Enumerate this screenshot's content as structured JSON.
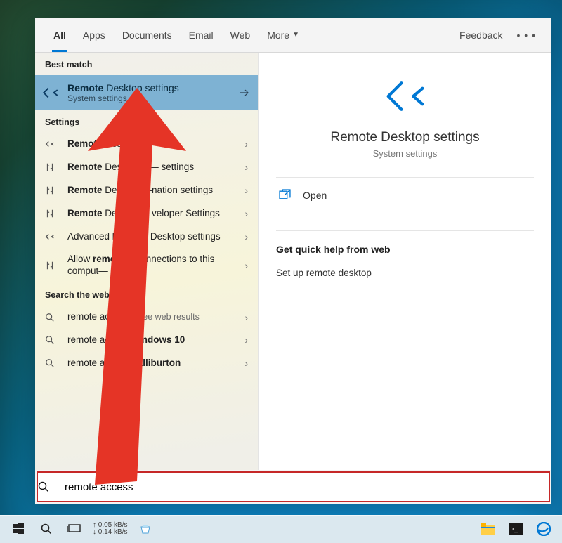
{
  "tabs": {
    "items": [
      "All",
      "Apps",
      "Documents",
      "Email",
      "Web",
      "More"
    ],
    "feedback": "Feedback"
  },
  "left": {
    "best_header": "Best match",
    "best": {
      "title_bold": "Remote",
      "title_rest": " Desktop settings",
      "subtitle": "System settings"
    },
    "settings_header": "Settings",
    "settings": [
      {
        "icon": "remote",
        "pre": "",
        "bold": "Remote",
        "post": " Desktop"
      },
      {
        "icon": "sliders",
        "pre": "",
        "bold": "Remote",
        "post": " Desktop sl— settings"
      },
      {
        "icon": "sliders",
        "pre": "",
        "bold": "Remote",
        "post": " Desktop —nation settings"
      },
      {
        "icon": "sliders",
        "pre": "",
        "bold": "Remote",
        "post": " Desktop —veloper Settings"
      },
      {
        "icon": "remote",
        "pre": "Advanced ",
        "bold": "Rem—e",
        "post": " Desktop settings"
      },
      {
        "icon": "sliders",
        "pre": "Allow ",
        "bold": "remot—",
        "post": " —onnections to this comput—"
      }
    ],
    "web_header": "Search the web",
    "web": [
      {
        "label": "remote access",
        "suffix": " - See web results"
      },
      {
        "label_pre": "remote access ",
        "bold": "windows 10"
      },
      {
        "label_pre": "remote access ",
        "bold": "halliburton"
      }
    ]
  },
  "right": {
    "title": "Remote Desktop settings",
    "subtitle": "System settings",
    "open": "Open",
    "help_header": "Get quick help from web",
    "help_link": "Set up remote desktop"
  },
  "search": {
    "value": "remote access"
  },
  "taskbar": {
    "up": "0.05 kB/s",
    "down": "0.14 kB/s"
  }
}
